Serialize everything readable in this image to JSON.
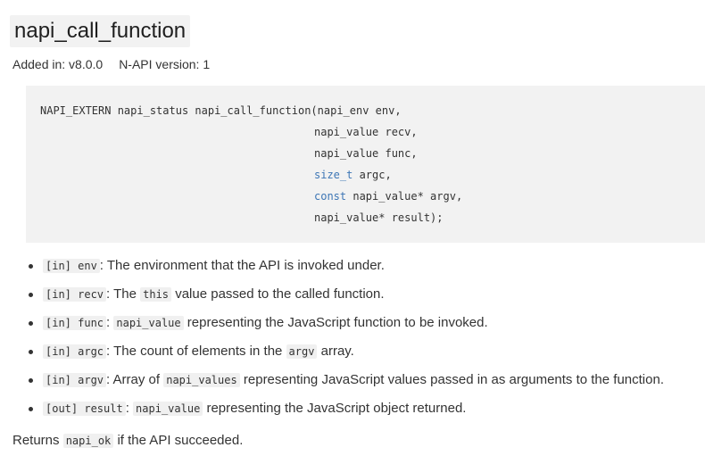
{
  "heading": {
    "title": "napi_call_function"
  },
  "meta": {
    "added_in": "Added in: v8.0.0",
    "napi_version": "N-API version: 1"
  },
  "signature": {
    "line1": "NAPI_EXTERN napi_status napi_call_function(napi_env env,",
    "line2": "napi_value recv,",
    "line3": "napi_value func,",
    "line4_type": "size_t",
    "line4_rest": " argc,",
    "line5_kw": "const",
    "line5_rest": " napi_value* argv,",
    "line6": "napi_value* result);"
  },
  "params": [
    {
      "tag": "[in] env",
      "sep": ":",
      "desc": " The environment that the API is invoked under."
    },
    {
      "tag": "[in] recv",
      "sep": ":",
      "desc_a": " The ",
      "code": "this",
      "desc_b": " value passed to the called function."
    },
    {
      "tag": "[in] func",
      "sep": ":",
      "code": "napi_value",
      "desc_b": " representing the JavaScript function to be invoked."
    },
    {
      "tag": "[in] argc",
      "sep": ":",
      "desc_a": " The count of elements in the ",
      "code": "argv",
      "desc_b": " array."
    },
    {
      "tag": "[in] argv",
      "sep": ":",
      "desc_a": " Array of ",
      "code": "napi_values",
      "desc_b": " representing JavaScript values passed in as arguments to the function."
    },
    {
      "tag": "[out] result",
      "sep": ":",
      "code": "napi_value",
      "desc_b": " representing the JavaScript object returned."
    }
  ],
  "returns": {
    "prefix": "Returns ",
    "code": "napi_ok",
    "suffix": " if the API succeeded."
  },
  "colors": {
    "code_bg": "#f2f2f2",
    "keyword": "#3d76b5",
    "text": "#333333"
  }
}
